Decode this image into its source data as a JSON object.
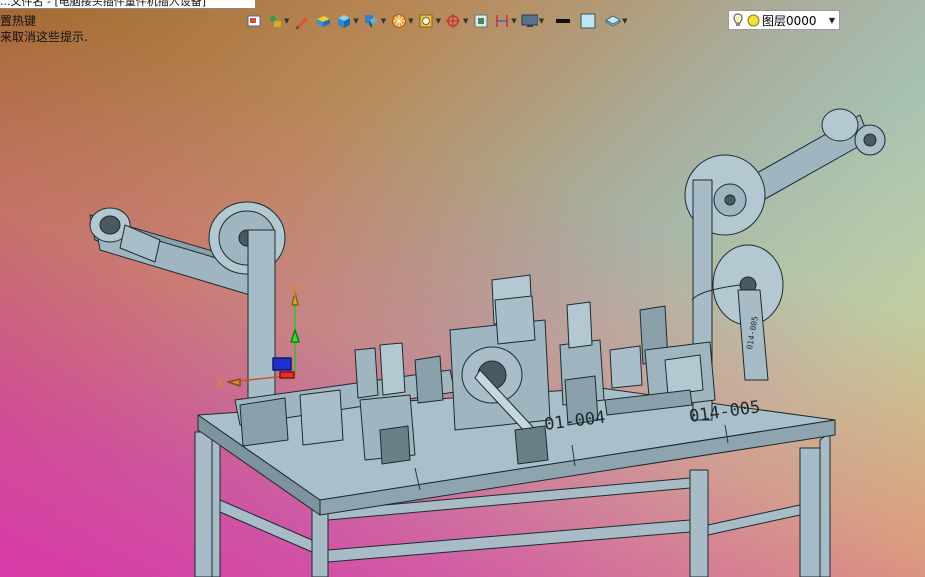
{
  "tab": {
    "title": "...文件名 - [电脑接头插件量件机插入设备]"
  },
  "hints": {
    "line1": "置热键",
    "line2": "来取消这些提示."
  },
  "toolbar": {
    "items": [
      {
        "icon": "save-view-icon"
      },
      {
        "icon": "snap-icon"
      },
      {
        "icon": "pen-icon"
      },
      {
        "icon": "solid-icon"
      },
      {
        "icon": "cube-icon"
      },
      {
        "icon": "box-view-icon"
      },
      {
        "icon": "render-icon"
      },
      {
        "icon": "lens-icon"
      },
      {
        "icon": "target-icon"
      },
      {
        "icon": "section-icon"
      },
      {
        "icon": "dimension-icon"
      },
      {
        "icon": "monitor-icon"
      },
      {
        "icon": "line-color-icon"
      },
      {
        "icon": "fill-color-icon"
      },
      {
        "icon": "layer-manager-icon"
      }
    ]
  },
  "layer": {
    "current": "图层0000"
  },
  "model": {
    "stations": [
      "01-004",
      "014-005",
      "014-005"
    ],
    "axis": {
      "x": "X",
      "y": "Y"
    },
    "colors": {
      "body": "#9fb6c0",
      "stroke": "#1d2a30",
      "dark": "#4a5a62",
      "frame": "#a7bcc6"
    }
  }
}
